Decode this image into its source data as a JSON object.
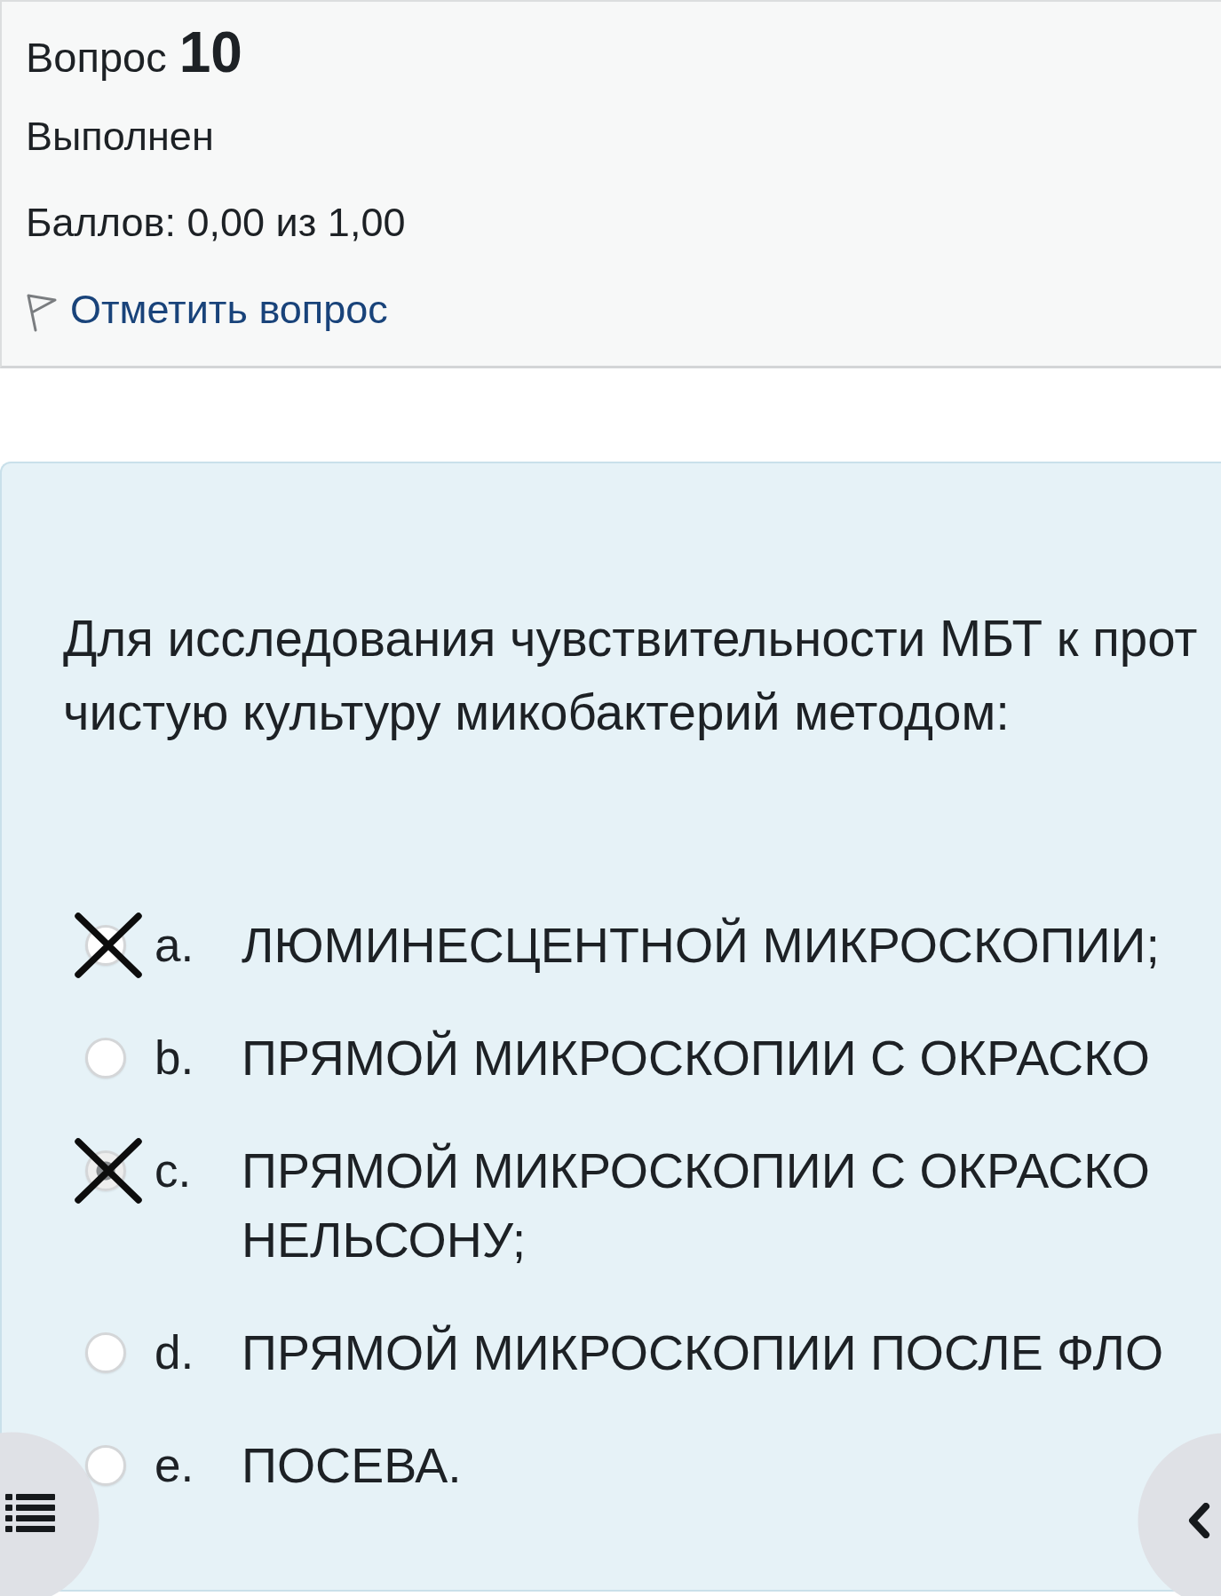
{
  "question_info": {
    "title": "Вопрос",
    "number": "10",
    "status": "Выполнен",
    "grade": "Баллов: 0,00 из 1,00",
    "flag_link": "Отметить вопрос"
  },
  "question": {
    "text_lines": [
      "Для исследования чувствительности МБТ к прот",
      "чистую культуру микобактерий методом:"
    ],
    "options": [
      {
        "letter": "a.",
        "text_lines": [
          "ЛЮМИНЕСЦЕНТНОЙ МИКРОСКОПИИ;"
        ],
        "selected": false,
        "crossed_out": true
      },
      {
        "letter": "b.",
        "text_lines": [
          "ПРЯМОЙ МИКРОСКОПИИ С ОКРАСКО"
        ],
        "selected": false,
        "crossed_out": false
      },
      {
        "letter": "c.",
        "text_lines": [
          "ПРЯМОЙ МИКРОСКОПИИ С ОКРАСКО",
          "НЕЛЬСОНУ;"
        ],
        "selected": true,
        "crossed_out": true
      },
      {
        "letter": "d.",
        "text_lines": [
          "ПРЯМОЙ МИКРОСКОПИИ ПОСЛЕ ФЛО"
        ],
        "selected": false,
        "crossed_out": false
      },
      {
        "letter": "e.",
        "text_lines": [
          "ПОСЕВА."
        ],
        "selected": false,
        "crossed_out": false
      }
    ]
  }
}
